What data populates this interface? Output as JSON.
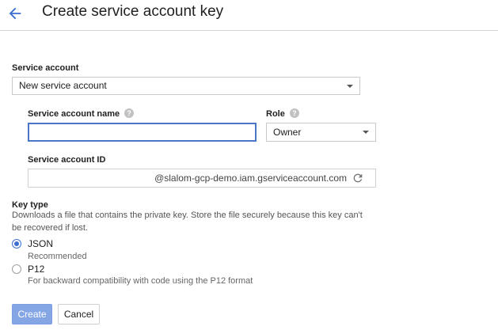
{
  "header": {
    "title": "Create service account key",
    "back_icon": "arrow-back-icon"
  },
  "form": {
    "service_account": {
      "label": "Service account",
      "selected": "New service account"
    },
    "service_account_name": {
      "label": "Service account name",
      "value": ""
    },
    "role": {
      "label": "Role",
      "selected": "Owner"
    },
    "service_account_id": {
      "label": "Service account ID",
      "value": "",
      "suffix": "@slalom-gcp-demo.iam.gserviceaccount.com"
    },
    "key_type": {
      "label": "Key type",
      "description": "Downloads a file that contains the private key. Store the file securely because this key can't be recovered if lost.",
      "options": [
        {
          "label": "JSON",
          "sublabel": "Recommended",
          "checked": true
        },
        {
          "label": "P12",
          "sublabel": "For backward compatibility with code using the P12 format",
          "checked": false
        }
      ]
    }
  },
  "actions": {
    "create_label": "Create",
    "cancel_label": "Cancel"
  },
  "colors": {
    "accent": "#3b6fd0",
    "create_button_bg": "#85a6e5",
    "input_focus_border": "#4a76c8"
  }
}
